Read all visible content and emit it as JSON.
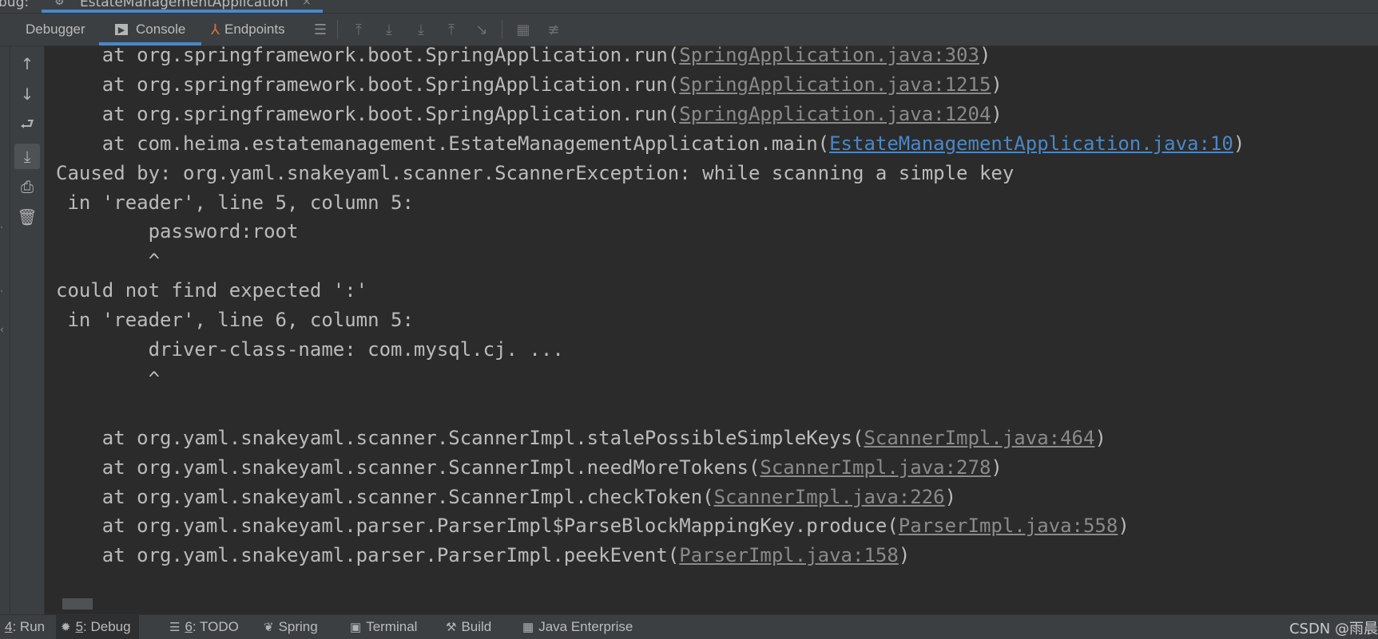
{
  "top_strip": {
    "label": "bug:",
    "tab_title": "EstateManagementApplication",
    "tab_icon": "spring-boot-icon",
    "close_glyph": "×"
  },
  "toolbar": {
    "debugger_label": "Debugger",
    "console_label": "Console",
    "endpoints_label": "Endpoints"
  },
  "console": {
    "lines": [
      {
        "indent": "    ",
        "prefix": "at org.springframework.boot.SpringApplication.run(",
        "link": "SpringApplication.java:303",
        "suffix": ")",
        "link_color": "gray"
      },
      {
        "indent": "    ",
        "prefix": "at org.springframework.boot.SpringApplication.run(",
        "link": "SpringApplication.java:1215",
        "suffix": ")",
        "link_color": "gray"
      },
      {
        "indent": "    ",
        "prefix": "at org.springframework.boot.SpringApplication.run(",
        "link": "SpringApplication.java:1204",
        "suffix": ")",
        "link_color": "gray"
      },
      {
        "indent": "    ",
        "prefix": "at com.heima.estatemanagement.EstateManagementApplication.main(",
        "link": "EstateManagementApplication.java:10",
        "suffix": ")",
        "link_color": "blue"
      },
      {
        "indent": "",
        "prefix": "Caused by: org.yaml.snakeyaml.scanner.ScannerException: while scanning a simple key",
        "link": "",
        "suffix": ""
      },
      {
        "indent": " ",
        "prefix": "in 'reader', line 5, column 5:",
        "link": "",
        "suffix": ""
      },
      {
        "indent": "        ",
        "prefix": "password:root",
        "link": "",
        "suffix": ""
      },
      {
        "indent": "        ",
        "prefix": "^",
        "link": "",
        "suffix": ""
      },
      {
        "indent": "",
        "prefix": "could not find expected ':'",
        "link": "",
        "suffix": ""
      },
      {
        "indent": " ",
        "prefix": "in 'reader', line 6, column 5:",
        "link": "",
        "suffix": ""
      },
      {
        "indent": "        ",
        "prefix": "driver-class-name: com.mysql.cj. ...",
        "link": "",
        "suffix": ""
      },
      {
        "indent": "        ",
        "prefix": "^",
        "link": "",
        "suffix": ""
      },
      {
        "indent": "",
        "prefix": "",
        "link": "",
        "suffix": ""
      },
      {
        "indent": "    ",
        "prefix": "at org.yaml.snakeyaml.scanner.ScannerImpl.stalePossibleSimpleKeys(",
        "link": "ScannerImpl.java:464",
        "suffix": ")",
        "link_color": "gray"
      },
      {
        "indent": "    ",
        "prefix": "at org.yaml.snakeyaml.scanner.ScannerImpl.needMoreTokens(",
        "link": "ScannerImpl.java:278",
        "suffix": ")",
        "link_color": "gray"
      },
      {
        "indent": "    ",
        "prefix": "at org.yaml.snakeyaml.scanner.ScannerImpl.checkToken(",
        "link": "ScannerImpl.java:226",
        "suffix": ")",
        "link_color": "gray"
      },
      {
        "indent": "    ",
        "prefix": "at org.yaml.snakeyaml.parser.ParserImpl$ParseBlockMappingKey.produce(",
        "link": "ParserImpl.java:558",
        "suffix": ")",
        "link_color": "gray"
      },
      {
        "indent": "    ",
        "prefix": "at org.yaml.snakeyaml.parser.ParserImpl.peekEvent(",
        "link": "ParserImpl.java:158",
        "suffix": ")",
        "link_color": "gray"
      }
    ]
  },
  "statusbar": {
    "tabs": [
      {
        "num": "4",
        "label": ": Run",
        "icon": "run-icon"
      },
      {
        "num": "5",
        "label": ": Debug",
        "icon": "debug-bug-icon"
      },
      {
        "num": "6",
        "label": ": TODO",
        "icon": "todo-list-icon"
      },
      {
        "num": "",
        "label": "Spring",
        "icon": "spring-leaf-icon"
      },
      {
        "num": "",
        "label": "Terminal",
        "icon": "terminal-icon"
      },
      {
        "num": "",
        "label": "Build",
        "icon": "hammer-icon"
      },
      {
        "num": "",
        "label": "Java Enterprise",
        "icon": "java-enterprise-icon"
      }
    ],
    "watermark": "CSDN @雨晨"
  },
  "colors": {
    "accent": "#4a88c7",
    "background": "#2b2b2b",
    "panel": "#3c3f41",
    "text": "#bbbbbb",
    "link_gray": "#8a8a8a",
    "endpoints_icon": "#d9733c"
  }
}
